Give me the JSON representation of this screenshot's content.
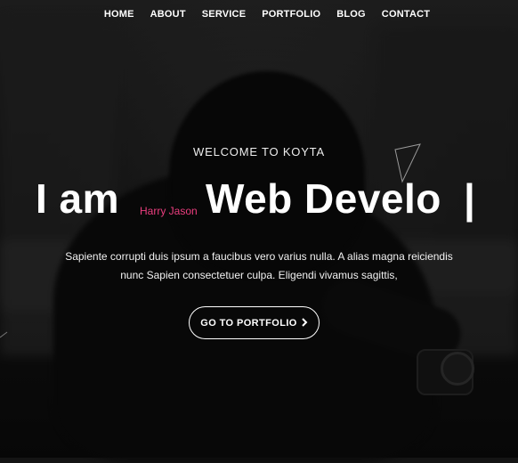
{
  "nav": {
    "items": [
      {
        "label": "HOME"
      },
      {
        "label": "ABOUT"
      },
      {
        "label": "SERVICE"
      },
      {
        "label": "PORTFOLIO"
      },
      {
        "label": "BLOG"
      },
      {
        "label": "CONTACT"
      }
    ]
  },
  "hero": {
    "welcome": "WELCOME TO KOYTA",
    "headline_prefix": "I am",
    "name": "Harry Jason",
    "headline_role": "Web Develo",
    "cursor": "|",
    "description_line1": "Sapiente corrupti duis ipsum a faucibus vero varius nulla. A alias magna reiciendis",
    "description_line2": "nunc Sapien consectetuer culpa. Eligendi vivamus sagittis,",
    "cta_label": "GO TO PORTFOLIO",
    "cta_icon": "chevron-right-icon"
  },
  "colors": {
    "accent": "#ec3e7f",
    "text": "#ffffff",
    "background": "#141414"
  }
}
